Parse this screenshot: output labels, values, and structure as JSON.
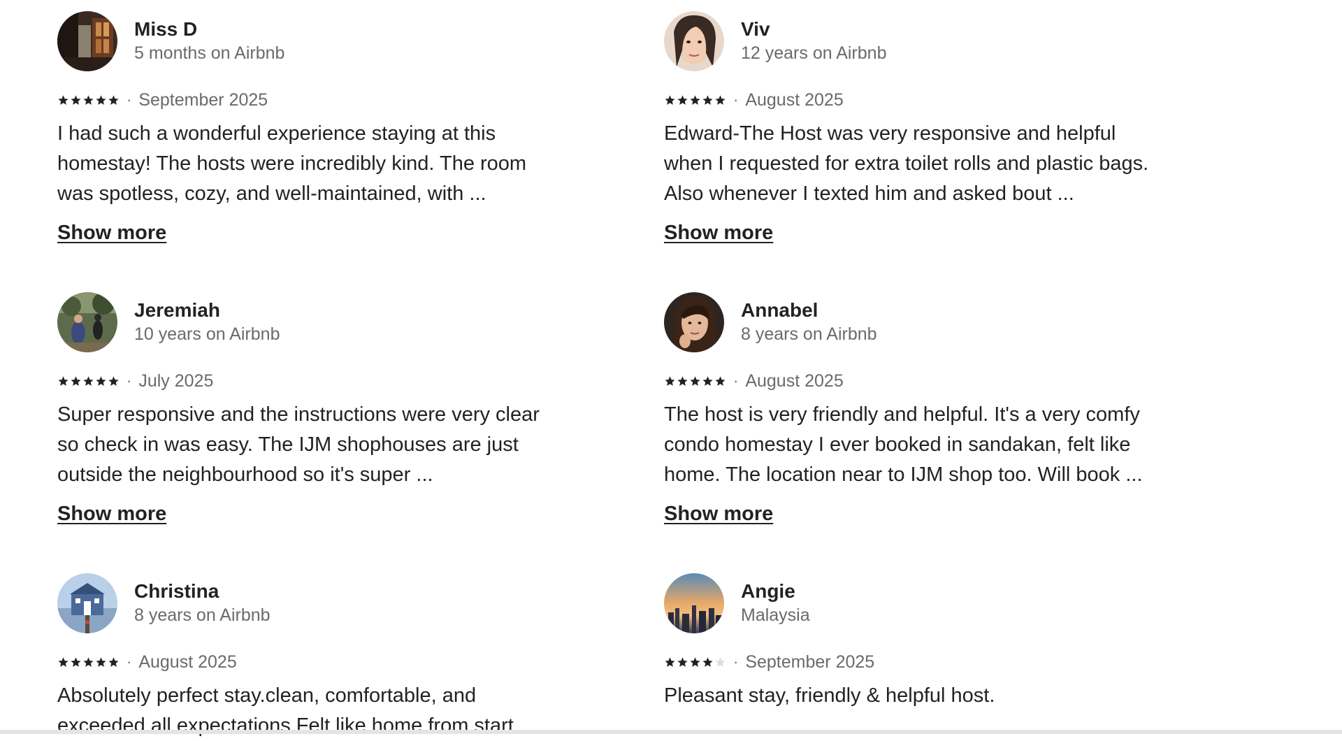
{
  "reviews": [
    {
      "name": "Miss D",
      "tenure": "5 months on Airbnb",
      "rating": 5,
      "date": "September 2025",
      "text": "I had such a wonderful experience staying at this homestay! The hosts were incredibly kind. The room was spotless, cozy, and well-maintained, with ...",
      "show_more": "Show more",
      "avatar": "avatar-photo-interior"
    },
    {
      "name": "Viv",
      "tenure": "12 years on Airbnb",
      "rating": 5,
      "date": "August 2025",
      "text": "Edward-The Host was very responsive and helpful when I requested for extra toilet rolls and plastic bags. Also whenever I texted him and asked bout ...",
      "show_more": "Show more",
      "avatar": "avatar-photo-portrait"
    },
    {
      "name": "Jeremiah",
      "tenure": "10 years on Airbnb",
      "rating": 5,
      "date": "July 2025",
      "text": "Super responsive and the instructions were very clear so check in was easy. The IJM shophouses are just outside the neighbourhood so it's super ...",
      "show_more": "Show more",
      "avatar": "avatar-photo-outdoors"
    },
    {
      "name": "Annabel",
      "tenure": "8 years on Airbnb",
      "rating": 5,
      "date": "August 2025",
      "text": "The host is very friendly and helpful. It's a very comfy condo homestay I ever booked in sandakan, felt like home. The location near to IJM shop too. Will book ...",
      "show_more": "Show more",
      "avatar": "avatar-photo-portrait-dark"
    },
    {
      "name": "Christina",
      "tenure": "8 years on Airbnb",
      "rating": 5,
      "date": "August 2025",
      "text": "Absolutely perfect stay.clean, comfortable, and exceeded all expectations.Felt like home from start",
      "show_more": "",
      "avatar": "avatar-photo-blue-house"
    },
    {
      "name": "Angie",
      "tenure": "Malaysia",
      "rating": 4,
      "date": "September 2025",
      "text": "Pleasant stay, friendly & helpful host.",
      "show_more": "",
      "avatar": "avatar-photo-sunset-city"
    }
  ],
  "colors": {
    "text_primary": "#222222",
    "text_secondary": "#6a6a6a",
    "star_filled": "#222222",
    "star_empty": "#dddddd"
  }
}
